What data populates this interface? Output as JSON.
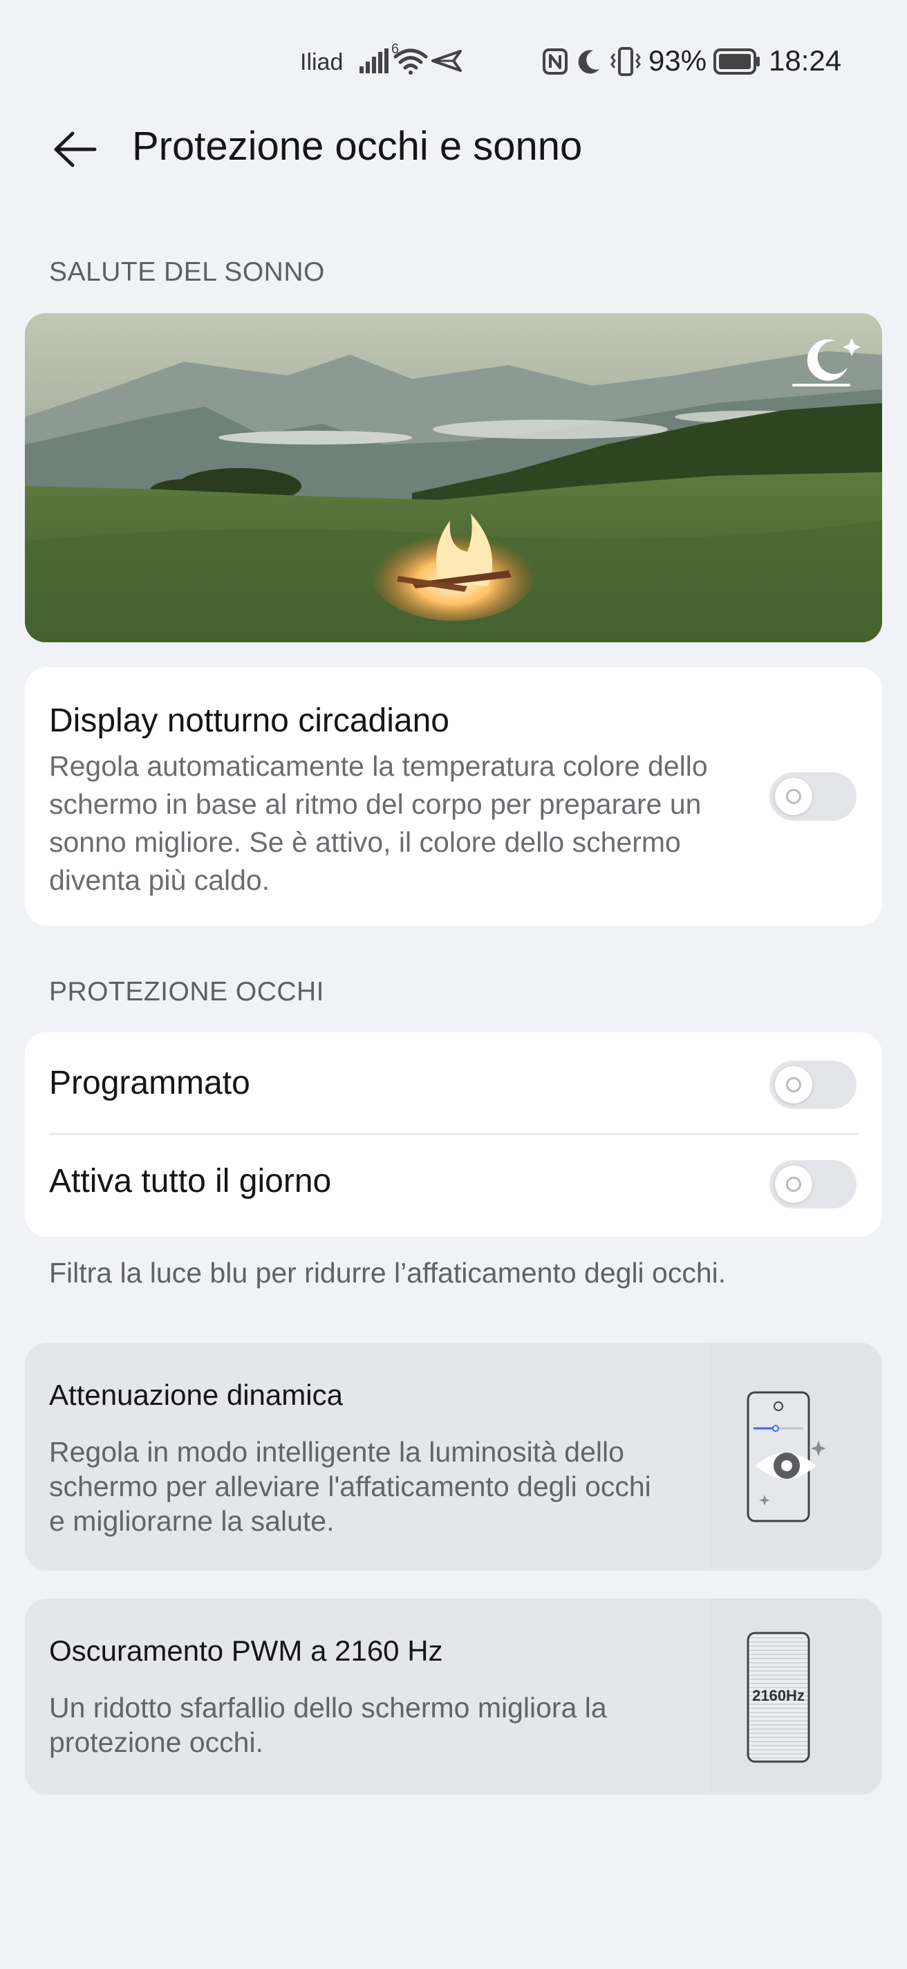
{
  "status_bar": {
    "carrier": "Iliad",
    "network_badge": "6",
    "battery_percent": "93%",
    "time": "18:24",
    "icons": [
      "signal-icon",
      "wifi-icon",
      "location-arrow-icon",
      "nfc-icon",
      "moon-icon",
      "vibrate-icon",
      "battery-icon"
    ]
  },
  "header": {
    "title": "Protezione occhi e sonno",
    "back_icon": "arrow-left-icon"
  },
  "sleep_section": {
    "label": "SALUTE DEL SONNO",
    "banner_icon": "moon-stars-icon",
    "circadian": {
      "title": "Display notturno circadiano",
      "description": "Regola automaticamente la temperatura colore dello schermo in base al ritmo del corpo per preparare un sonno migliore. Se è attivo, il colore dello schermo diventa più caldo.",
      "enabled": false
    }
  },
  "eye_section": {
    "label": "PROTEZIONE OCCHI",
    "rows": [
      {
        "title": "Programmato",
        "enabled": false
      },
      {
        "title": "Attiva tutto il giorno",
        "enabled": false
      }
    ],
    "footnote": "Filtra la luce blu per ridurre l’affaticamento degli occhi."
  },
  "features": [
    {
      "title": "Attenuazione dinamica",
      "description": "Regola in modo intelligente la luminosità dello schermo per alleviare l'affaticamento degli occhi e migliorarne la salute.",
      "icon": "phone-eye-icon"
    },
    {
      "title": "Oscuramento PWM a 2160 Hz",
      "description": "Un ridotto sfarfallio dello schermo migliora la protezione occhi.",
      "icon": "phone-hz-icon",
      "icon_text": "2160Hz"
    }
  ],
  "colors": {
    "background": "#f1f2f6",
    "card": "#ffffff",
    "toggle_off": "#e4e5e9",
    "accent": "#3b6cf0"
  }
}
